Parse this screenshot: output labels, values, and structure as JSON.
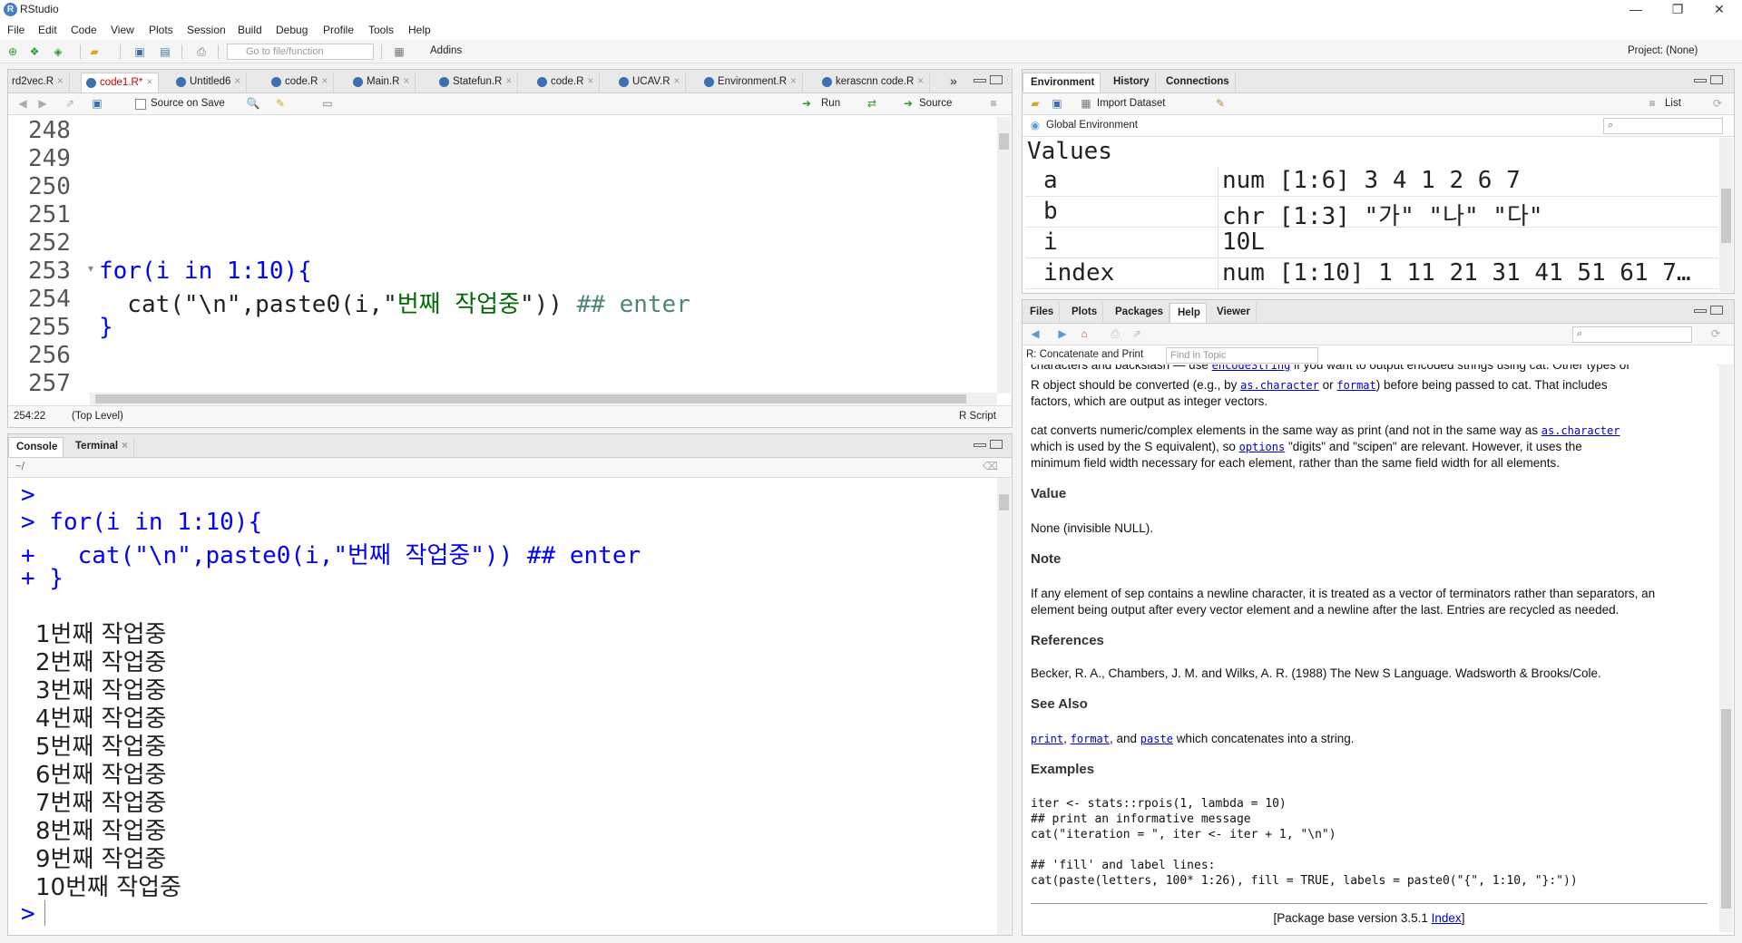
{
  "window": {
    "title": "RStudio"
  },
  "menu": [
    "File",
    "Edit",
    "Code",
    "View",
    "Plots",
    "Session",
    "Build",
    "Debug",
    "Profile",
    "Tools",
    "Help"
  ],
  "toolbar": {
    "goto_placeholder": "Go to file/function",
    "addins": "Addins",
    "project": "Project: (None)"
  },
  "editor": {
    "tabs": [
      "rd2vec.R",
      "code1.R*",
      "Untitled6",
      "code.R",
      "Main.R",
      "Statefun.R",
      "code.R",
      "UCAV.R",
      "Environment.R",
      "kerascnn code.R"
    ],
    "active_tab": "code1.R*",
    "source_on_save": "Source on Save",
    "run": "Run",
    "source": "Source",
    "line_numbers": [
      "248",
      "249",
      "250",
      "251",
      "252",
      "253",
      "254",
      "255",
      "256",
      "257"
    ],
    "code": {
      "l253_kw": "for(i in 1:10){",
      "l254_a": "  cat(\"\\n\",paste0(i,\"",
      "l254_str": "번째 작업중",
      "l254_b": "\")) ",
      "l254_cmt": "## enter",
      "l255": "}"
    },
    "status_pos": "254:22",
    "status_scope": "(Top Level)",
    "status_type": "R Script"
  },
  "console": {
    "tabs": [
      "Console",
      "Terminal"
    ],
    "path": "~/",
    "lines": [
      ">",
      "> for(i in 1:10){",
      "+   cat(\"\\n\",paste0(i,\"번째 작업중\")) ## enter",
      "+ }"
    ],
    "output": [
      "1번째 작업중",
      "2번째 작업중",
      "3번째 작업중",
      "4번째 작업중",
      "5번째 작업중",
      "6번째 작업중",
      "7번째 작업중",
      "8번째 작업중",
      "9번째 작업중",
      "10번째 작업중"
    ],
    "prompt": ">"
  },
  "environment": {
    "tabs": [
      "Environment",
      "History",
      "Connections"
    ],
    "import_dataset": "Import Dataset",
    "list_view": "List",
    "scope": "Global Environment",
    "section": "Values",
    "rows": [
      {
        "name": "a",
        "value": "num [1:6] 3 4 1 2 6 7"
      },
      {
        "name": "b",
        "value": "chr [1:3] \"가\" \"나\" \"다\""
      },
      {
        "name": "i",
        "value": "10L"
      },
      {
        "name": "index",
        "value": "num [1:10] 1 11 21 31 41 51 61 7…"
      }
    ]
  },
  "help": {
    "tabs": [
      "Files",
      "Plots",
      "Packages",
      "Help",
      "Viewer"
    ],
    "topic": "R: Concatenate and Print",
    "find_placeholder": "Find in Topic",
    "p0a": "characters and backslash — use",
    "p0_link": "encodeString",
    "p0b": "if you want to output encoded strings using cat. Other types of",
    "p1a": "R object should be converted (e.g., by",
    "p1_link1": "as.character",
    "p1b": "or",
    "p1_link2": "format",
    "p1c": ") before being passed to cat. That includes",
    "p1d": "factors, which are output as integer vectors.",
    "p2a": "cat converts numeric/complex elements in the same way as print (and not in the same way as",
    "p2_link": "as.character",
    "p2b": "which is used by the S equivalent), so",
    "p2_link2": "options",
    "p2c": "\"digits\" and \"scipen\" are relevant. However, it uses the",
    "p2d": "minimum field width necessary for each element, rather than the same field width for all elements.",
    "h_value": "Value",
    "value_text": "None (invisible NULL).",
    "h_note": "Note",
    "note_a": "If any element of sep contains a newline character, it is treated as a vector of terminators rather than separators, an",
    "note_b": "element being output after every vector element and a newline after the last. Entries are recycled as needed.",
    "h_refs": "References",
    "refs": "Becker, R. A., Chambers, J. M. and Wilks, A. R. (1988) The New S Language. Wadsworth & Brooks/Cole.",
    "h_see": "See Also",
    "see_l1": "print",
    "see_l2": "format",
    "see_and": ", and",
    "see_l3": "paste",
    "see_rest": "which concatenates into a string.",
    "h_examples": "Examples",
    "ex": [
      "iter <- stats::rpois(1, lambda = 10)",
      "## print an informative message",
      "cat(\"iteration = \", iter <- iter + 1, \"\\n\")",
      "",
      "## 'fill' and label lines:",
      "cat(paste(letters, 100* 1:26), fill = TRUE, labels = paste0(\"{\", 1:10, \"}:\"))"
    ],
    "footer_a": "[Package base version 3.5.1",
    "footer_link": "Index",
    "footer_b": "]"
  }
}
